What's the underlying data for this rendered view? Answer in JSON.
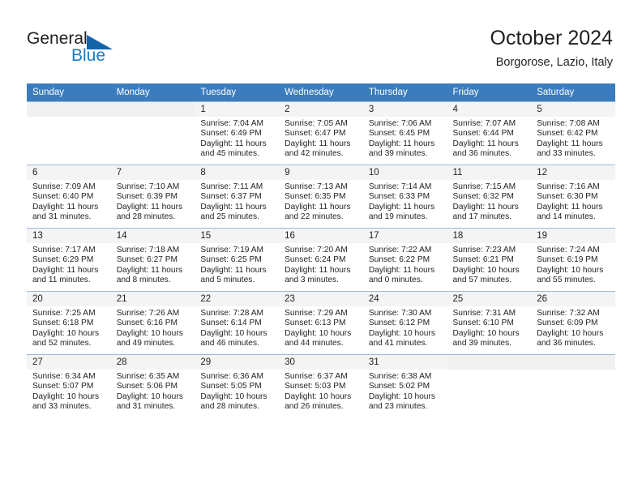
{
  "brand": {
    "name_top": "General",
    "name_bottom": "Blue",
    "accent_color": "#1b7bc1",
    "triangle_color": "#1463a8"
  },
  "header": {
    "title": "October 2024",
    "subtitle": "Borgorose, Lazio, Italy"
  },
  "theme": {
    "header_row_bg": "#3a7cbe",
    "header_row_text": "#ffffff",
    "daynum_bg": "#f0f0f0",
    "grid_line": "#9fb9d4",
    "text": "#231f20"
  },
  "weekdays": [
    "Sunday",
    "Monday",
    "Tuesday",
    "Wednesday",
    "Thursday",
    "Friday",
    "Saturday"
  ],
  "labels": {
    "sunrise_prefix": "Sunrise:",
    "sunset_prefix": "Sunset:",
    "daylight_prefix": "Daylight:"
  },
  "weeks": [
    [
      {
        "day": "",
        "l1": "",
        "l2": "",
        "l3": "",
        "l4": "",
        "empty": true
      },
      {
        "day": "",
        "l1": "",
        "l2": "",
        "l3": "",
        "l4": "",
        "empty": true
      },
      {
        "day": "1",
        "l1": "Sunrise: 7:04 AM",
        "l2": "Sunset: 6:49 PM",
        "l3": "Daylight: 11 hours",
        "l4": "and 45 minutes."
      },
      {
        "day": "2",
        "l1": "Sunrise: 7:05 AM",
        "l2": "Sunset: 6:47 PM",
        "l3": "Daylight: 11 hours",
        "l4": "and 42 minutes."
      },
      {
        "day": "3",
        "l1": "Sunrise: 7:06 AM",
        "l2": "Sunset: 6:45 PM",
        "l3": "Daylight: 11 hours",
        "l4": "and 39 minutes."
      },
      {
        "day": "4",
        "l1": "Sunrise: 7:07 AM",
        "l2": "Sunset: 6:44 PM",
        "l3": "Daylight: 11 hours",
        "l4": "and 36 minutes."
      },
      {
        "day": "5",
        "l1": "Sunrise: 7:08 AM",
        "l2": "Sunset: 6:42 PM",
        "l3": "Daylight: 11 hours",
        "l4": "and 33 minutes."
      }
    ],
    [
      {
        "day": "6",
        "l1": "Sunrise: 7:09 AM",
        "l2": "Sunset: 6:40 PM",
        "l3": "Daylight: 11 hours",
        "l4": "and 31 minutes."
      },
      {
        "day": "7",
        "l1": "Sunrise: 7:10 AM",
        "l2": "Sunset: 6:39 PM",
        "l3": "Daylight: 11 hours",
        "l4": "and 28 minutes."
      },
      {
        "day": "8",
        "l1": "Sunrise: 7:11 AM",
        "l2": "Sunset: 6:37 PM",
        "l3": "Daylight: 11 hours",
        "l4": "and 25 minutes."
      },
      {
        "day": "9",
        "l1": "Sunrise: 7:13 AM",
        "l2": "Sunset: 6:35 PM",
        "l3": "Daylight: 11 hours",
        "l4": "and 22 minutes."
      },
      {
        "day": "10",
        "l1": "Sunrise: 7:14 AM",
        "l2": "Sunset: 6:33 PM",
        "l3": "Daylight: 11 hours",
        "l4": "and 19 minutes."
      },
      {
        "day": "11",
        "l1": "Sunrise: 7:15 AM",
        "l2": "Sunset: 6:32 PM",
        "l3": "Daylight: 11 hours",
        "l4": "and 17 minutes."
      },
      {
        "day": "12",
        "l1": "Sunrise: 7:16 AM",
        "l2": "Sunset: 6:30 PM",
        "l3": "Daylight: 11 hours",
        "l4": "and 14 minutes."
      }
    ],
    [
      {
        "day": "13",
        "l1": "Sunrise: 7:17 AM",
        "l2": "Sunset: 6:29 PM",
        "l3": "Daylight: 11 hours",
        "l4": "and 11 minutes."
      },
      {
        "day": "14",
        "l1": "Sunrise: 7:18 AM",
        "l2": "Sunset: 6:27 PM",
        "l3": "Daylight: 11 hours",
        "l4": "and 8 minutes."
      },
      {
        "day": "15",
        "l1": "Sunrise: 7:19 AM",
        "l2": "Sunset: 6:25 PM",
        "l3": "Daylight: 11 hours",
        "l4": "and 5 minutes."
      },
      {
        "day": "16",
        "l1": "Sunrise: 7:20 AM",
        "l2": "Sunset: 6:24 PM",
        "l3": "Daylight: 11 hours",
        "l4": "and 3 minutes."
      },
      {
        "day": "17",
        "l1": "Sunrise: 7:22 AM",
        "l2": "Sunset: 6:22 PM",
        "l3": "Daylight: 11 hours",
        "l4": "and 0 minutes."
      },
      {
        "day": "18",
        "l1": "Sunrise: 7:23 AM",
        "l2": "Sunset: 6:21 PM",
        "l3": "Daylight: 10 hours",
        "l4": "and 57 minutes."
      },
      {
        "day": "19",
        "l1": "Sunrise: 7:24 AM",
        "l2": "Sunset: 6:19 PM",
        "l3": "Daylight: 10 hours",
        "l4": "and 55 minutes."
      }
    ],
    [
      {
        "day": "20",
        "l1": "Sunrise: 7:25 AM",
        "l2": "Sunset: 6:18 PM",
        "l3": "Daylight: 10 hours",
        "l4": "and 52 minutes."
      },
      {
        "day": "21",
        "l1": "Sunrise: 7:26 AM",
        "l2": "Sunset: 6:16 PM",
        "l3": "Daylight: 10 hours",
        "l4": "and 49 minutes."
      },
      {
        "day": "22",
        "l1": "Sunrise: 7:28 AM",
        "l2": "Sunset: 6:14 PM",
        "l3": "Daylight: 10 hours",
        "l4": "and 46 minutes."
      },
      {
        "day": "23",
        "l1": "Sunrise: 7:29 AM",
        "l2": "Sunset: 6:13 PM",
        "l3": "Daylight: 10 hours",
        "l4": "and 44 minutes."
      },
      {
        "day": "24",
        "l1": "Sunrise: 7:30 AM",
        "l2": "Sunset: 6:12 PM",
        "l3": "Daylight: 10 hours",
        "l4": "and 41 minutes."
      },
      {
        "day": "25",
        "l1": "Sunrise: 7:31 AM",
        "l2": "Sunset: 6:10 PM",
        "l3": "Daylight: 10 hours",
        "l4": "and 39 minutes."
      },
      {
        "day": "26",
        "l1": "Sunrise: 7:32 AM",
        "l2": "Sunset: 6:09 PM",
        "l3": "Daylight: 10 hours",
        "l4": "and 36 minutes."
      }
    ],
    [
      {
        "day": "27",
        "l1": "Sunrise: 6:34 AM",
        "l2": "Sunset: 5:07 PM",
        "l3": "Daylight: 10 hours",
        "l4": "and 33 minutes."
      },
      {
        "day": "28",
        "l1": "Sunrise: 6:35 AM",
        "l2": "Sunset: 5:06 PM",
        "l3": "Daylight: 10 hours",
        "l4": "and 31 minutes."
      },
      {
        "day": "29",
        "l1": "Sunrise: 6:36 AM",
        "l2": "Sunset: 5:05 PM",
        "l3": "Daylight: 10 hours",
        "l4": "and 28 minutes."
      },
      {
        "day": "30",
        "l1": "Sunrise: 6:37 AM",
        "l2": "Sunset: 5:03 PM",
        "l3": "Daylight: 10 hours",
        "l4": "and 26 minutes."
      },
      {
        "day": "31",
        "l1": "Sunrise: 6:38 AM",
        "l2": "Sunset: 5:02 PM",
        "l3": "Daylight: 10 hours",
        "l4": "and 23 minutes."
      },
      {
        "day": "",
        "l1": "",
        "l2": "",
        "l3": "",
        "l4": "",
        "empty": true
      },
      {
        "day": "",
        "l1": "",
        "l2": "",
        "l3": "",
        "l4": "",
        "empty": true
      }
    ]
  ]
}
